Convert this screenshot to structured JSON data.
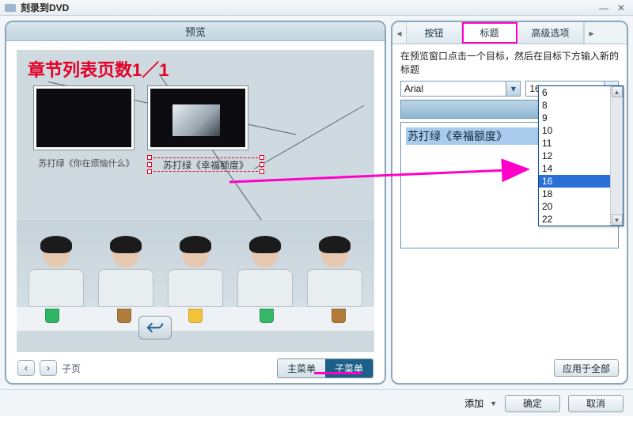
{
  "window": {
    "title": "刻录到DVD"
  },
  "preview": {
    "header": "预览",
    "page_counter": "章节列表页数1／1",
    "thumb1_caption": "苏打绿《你在烦恼什么》",
    "thumb2_caption_sel": "苏打绿《幸福额度》",
    "back_icon": "back-icon",
    "pager_label": "子页",
    "menu_main": "主菜单",
    "menu_sub": "子菜单"
  },
  "sidebar": {
    "tab_button": "按钮",
    "tab_caption": "标题",
    "tab_advanced": "高级选项",
    "instruction": "在预览窗口点击一个目标，然后在目标下方输入新的标题",
    "font_family": "Arial",
    "font_size": "16",
    "size_options": [
      "6",
      "8",
      "9",
      "10",
      "11",
      "12",
      "14",
      "16",
      "18",
      "20",
      "22"
    ],
    "current_label": "苏打绿《幸福额度》",
    "apply_all": "应用于全部"
  },
  "footer": {
    "add": "添加",
    "ok": "确定",
    "cancel": "取消"
  }
}
